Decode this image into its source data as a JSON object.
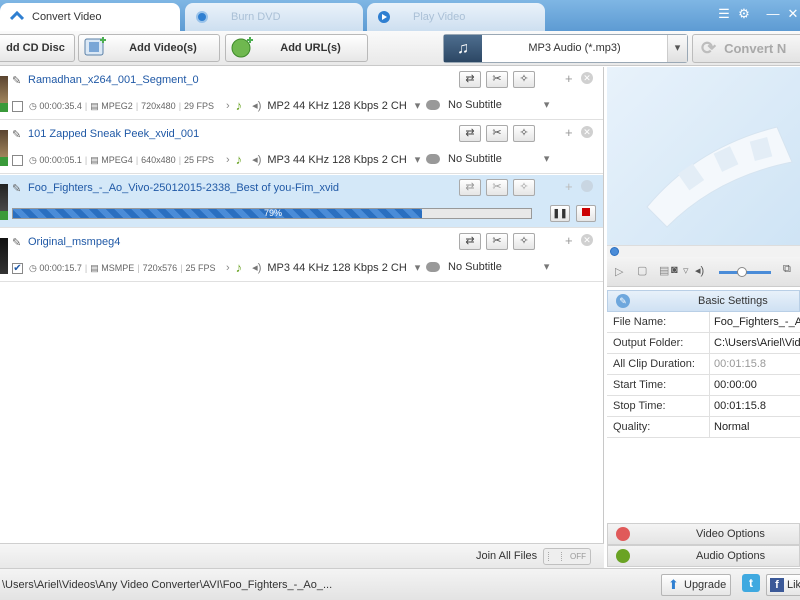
{
  "tabs": [
    {
      "label": "Convert Video"
    },
    {
      "label": "Burn DVD"
    },
    {
      "label": "Play Video"
    }
  ],
  "toolbar": {
    "add_cd": "dd CD Disc",
    "add_videos": "Add Video(s)",
    "add_url": "Add URL(s)",
    "format": "MP3 Audio (*.mp3)",
    "convert": "Convert N"
  },
  "files": [
    {
      "name": "Ramadhan_x264_001_Segment_0",
      "duration": "00:00:35.4",
      "codec": "MPEG2",
      "res": "720x480",
      "fps": "29 FPS",
      "audio": "MP2 44 KHz 128 Kbps 2 CH",
      "subtitle": "No Subtitle",
      "checked": false
    },
    {
      "name": "101 Zapped Sneak Peek_xvid_001",
      "duration": "00:00:05.1",
      "codec": "MPEG4",
      "res": "640x480",
      "fps": "25 FPS",
      "audio": "MP3 44 KHz 128 Kbps 2 CH",
      "subtitle": "No Subtitle",
      "checked": false
    },
    {
      "name": "Foo_Fighters_-_Ao_Vivo-25012015-2338_Best of you-Fim_xvid",
      "progress": 79,
      "progress_label": "79%"
    },
    {
      "name": "Original_msmpeg4",
      "duration": "00:00:15.7",
      "codec": "MSMPE",
      "res": "720x576",
      "fps": "25 FPS",
      "audio": "MP3 44 KHz 128 Kbps 2 CH",
      "subtitle": "No Subtitle",
      "checked": true
    }
  ],
  "join": {
    "label": "Join All Files",
    "toggle": "OFF"
  },
  "settings": {
    "header": "Basic Settings",
    "rows": [
      {
        "key": "File Name:",
        "value": "Foo_Fighters_-_Ao_"
      },
      {
        "key": "Output Folder:",
        "value": "C:\\Users\\Ariel\\Vide"
      },
      {
        "key": "All Clip Duration:",
        "value": "00:01:15.8"
      },
      {
        "key": "Start Time:",
        "value": "00:00:00"
      },
      {
        "key": "Stop Time:",
        "value": "00:01:15.8"
      },
      {
        "key": "Quality:",
        "value": "Normal"
      }
    ],
    "video_options": "Video Options",
    "audio_options": "Audio Options"
  },
  "status": {
    "path": "\\Users\\Ariel\\Videos\\Any Video Converter\\AVI\\Foo_Fighters_-_Ao_...",
    "upgrade": "Upgrade",
    "like": "Lik"
  }
}
